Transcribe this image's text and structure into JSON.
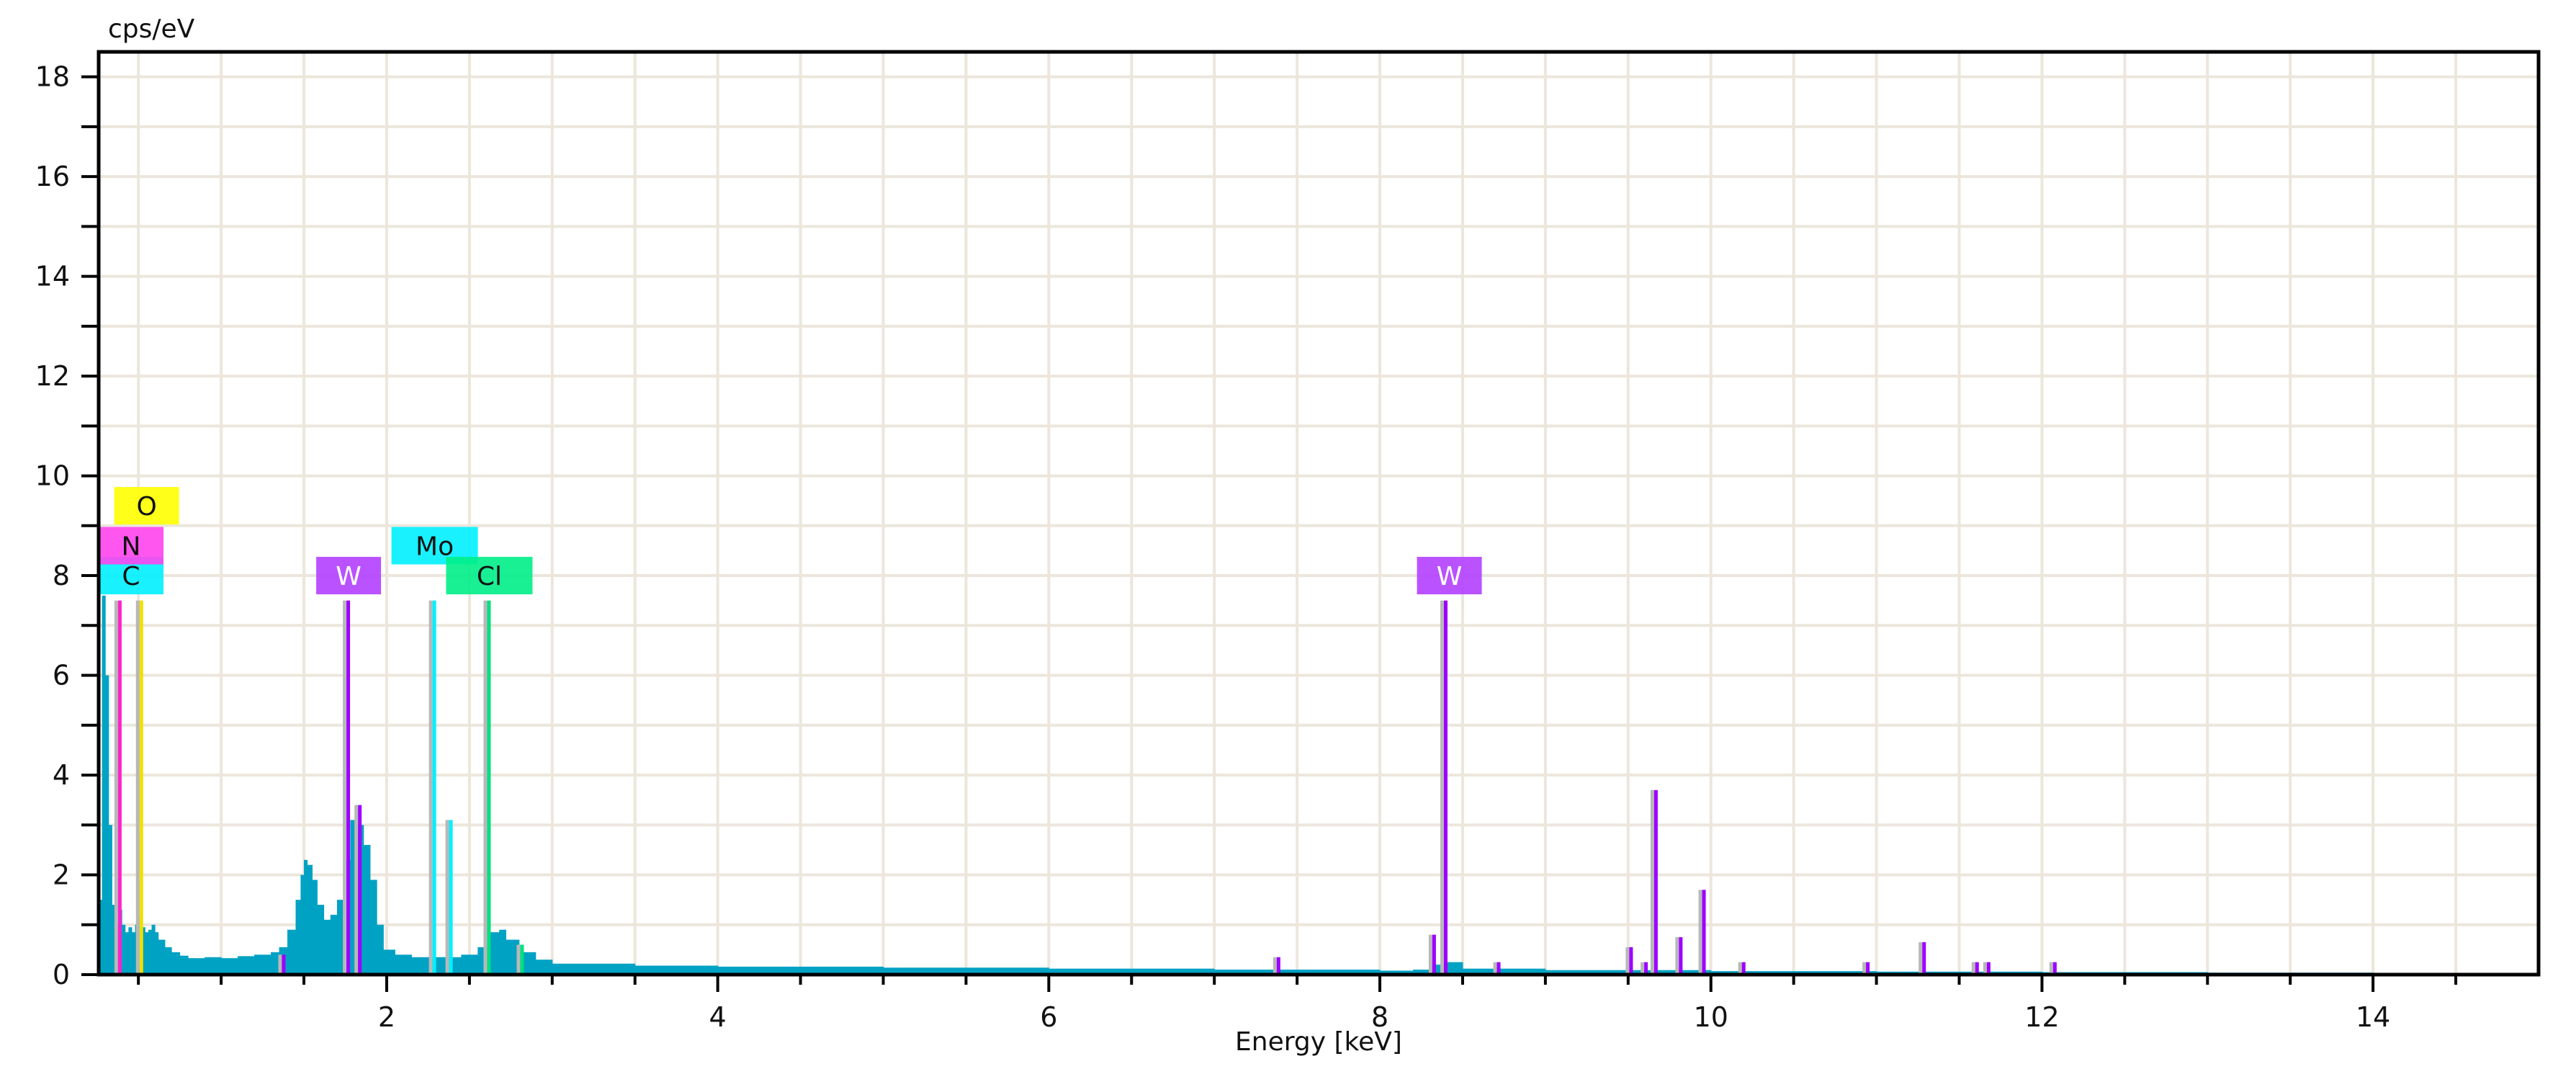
{
  "chart_data": {
    "type": "bar",
    "title": "",
    "xlabel": "Energy [keV]",
    "ylabel": "cps/eV",
    "xlim": [
      0.26,
      15.0
    ],
    "ylim": [
      0,
      18.5
    ],
    "grid": true,
    "xticks": [
      2,
      4,
      6,
      8,
      10,
      12,
      14
    ],
    "yticks": [
      0,
      2,
      4,
      6,
      8,
      10,
      12,
      14,
      16,
      18
    ],
    "spectrum_color": "#00a2c4",
    "spectrum": [
      [
        0.26,
        1.5
      ],
      [
        0.28,
        7.6
      ],
      [
        0.3,
        6.0
      ],
      [
        0.32,
        3.0
      ],
      [
        0.34,
        1.4
      ],
      [
        0.36,
        1.0
      ],
      [
        0.38,
        1.3
      ],
      [
        0.4,
        1.0
      ],
      [
        0.42,
        0.85
      ],
      [
        0.44,
        0.95
      ],
      [
        0.46,
        0.85
      ],
      [
        0.48,
        1.0
      ],
      [
        0.5,
        1.15
      ],
      [
        0.52,
        0.95
      ],
      [
        0.54,
        0.85
      ],
      [
        0.56,
        0.9
      ],
      [
        0.58,
        1.0
      ],
      [
        0.6,
        0.85
      ],
      [
        0.62,
        0.7
      ],
      [
        0.66,
        0.55
      ],
      [
        0.7,
        0.45
      ],
      [
        0.75,
        0.38
      ],
      [
        0.8,
        0.33
      ],
      [
        0.9,
        0.35
      ],
      [
        1.0,
        0.33
      ],
      [
        1.1,
        0.37
      ],
      [
        1.2,
        0.4
      ],
      [
        1.3,
        0.45
      ],
      [
        1.35,
        0.55
      ],
      [
        1.4,
        0.9
      ],
      [
        1.45,
        1.5
      ],
      [
        1.48,
        2.0
      ],
      [
        1.5,
        2.3
      ],
      [
        1.52,
        2.2
      ],
      [
        1.55,
        1.9
      ],
      [
        1.58,
        1.4
      ],
      [
        1.62,
        1.1
      ],
      [
        1.66,
        1.2
      ],
      [
        1.7,
        1.5
      ],
      [
        1.74,
        2.3
      ],
      [
        1.78,
        3.1
      ],
      [
        1.82,
        3.0
      ],
      [
        1.86,
        2.6
      ],
      [
        1.9,
        1.9
      ],
      [
        1.94,
        1.0
      ],
      [
        1.98,
        0.5
      ],
      [
        2.05,
        0.4
      ],
      [
        2.15,
        0.35
      ],
      [
        2.3,
        0.35
      ],
      [
        2.45,
        0.4
      ],
      [
        2.55,
        0.55
      ],
      [
        2.62,
        0.85
      ],
      [
        2.68,
        0.9
      ],
      [
        2.72,
        0.7
      ],
      [
        2.8,
        0.45
      ],
      [
        2.9,
        0.3
      ],
      [
        3.0,
        0.22
      ],
      [
        3.5,
        0.18
      ],
      [
        4.0,
        0.16
      ],
      [
        5.0,
        0.14
      ],
      [
        6.0,
        0.12
      ],
      [
        7.0,
        0.1
      ],
      [
        8.0,
        0.08
      ],
      [
        8.2,
        0.1
      ],
      [
        8.3,
        0.2
      ],
      [
        8.4,
        0.25
      ],
      [
        8.5,
        0.12
      ],
      [
        9.0,
        0.09
      ],
      [
        10.0,
        0.07
      ],
      [
        11.0,
        0.06
      ],
      [
        12.0,
        0.05
      ],
      [
        13.0,
        0.04
      ],
      [
        14.0,
        0.03
      ],
      [
        14.6,
        0.0
      ]
    ],
    "marker_lines": [
      {
        "energy": 0.39,
        "height": 7.5,
        "color": "#ff22cc"
      },
      {
        "energy": 0.52,
        "height": 7.5,
        "color": "#f0e000"
      },
      {
        "energy": 1.77,
        "height": 7.5,
        "color": "#9d00ff"
      },
      {
        "energy": 1.84,
        "height": 3.4,
        "color": "#9d00ff"
      },
      {
        "energy": 1.38,
        "height": 0.4,
        "color": "#9d00ff"
      },
      {
        "energy": 2.29,
        "height": 7.5,
        "color": "#00f0ff"
      },
      {
        "energy": 2.39,
        "height": 3.1,
        "color": "#00f0ff"
      },
      {
        "energy": 2.62,
        "height": 7.5,
        "color": "#00e080"
      },
      {
        "energy": 2.82,
        "height": 0.6,
        "color": "#00e080"
      },
      {
        "energy": 7.39,
        "height": 0.35,
        "color": "#9d00ff"
      },
      {
        "energy": 8.33,
        "height": 0.8,
        "color": "#9d00ff"
      },
      {
        "energy": 8.4,
        "height": 7.5,
        "color": "#9d00ff"
      },
      {
        "energy": 8.72,
        "height": 0.25,
        "color": "#9d00ff"
      },
      {
        "energy": 9.52,
        "height": 0.55,
        "color": "#9d00ff"
      },
      {
        "energy": 9.61,
        "height": 0.25,
        "color": "#9d00ff"
      },
      {
        "energy": 9.67,
        "height": 3.7,
        "color": "#9d00ff"
      },
      {
        "energy": 9.82,
        "height": 0.75,
        "color": "#9d00ff"
      },
      {
        "energy": 9.96,
        "height": 1.7,
        "color": "#9d00ff"
      },
      {
        "energy": 10.2,
        "height": 0.25,
        "color": "#9d00ff"
      },
      {
        "energy": 10.95,
        "height": 0.25,
        "color": "#9d00ff"
      },
      {
        "energy": 11.29,
        "height": 0.65,
        "color": "#9d00ff"
      },
      {
        "energy": 11.61,
        "height": 0.25,
        "color": "#9d00ff"
      },
      {
        "energy": 11.68,
        "height": 0.25,
        "color": "#9d00ff"
      },
      {
        "energy": 12.08,
        "height": 0.25,
        "color": "#9d00ff"
      }
    ],
    "element_labels": [
      {
        "text": "C",
        "energy": 0.28,
        "level": 8.0,
        "bg": "#00f0ff",
        "fg": "#111111"
      },
      {
        "text": "N",
        "energy": 0.38,
        "level": 8.6,
        "bg": "#ff44ee",
        "fg": "#111111"
      },
      {
        "text": "O",
        "energy": 0.55,
        "level": 9.4,
        "bg": "#ffff00",
        "fg": "#111111"
      },
      {
        "text": "W",
        "energy": 1.77,
        "level": 8.0,
        "bg": "#b340ff",
        "fg": "#ffffff"
      },
      {
        "text": "Mo",
        "energy": 2.29,
        "level": 8.6,
        "bg": "#00f0ff",
        "fg": "#111111"
      },
      {
        "text": "Cl",
        "energy": 2.62,
        "level": 8.0,
        "bg": "#00ee88",
        "fg": "#111111"
      },
      {
        "text": "W",
        "energy": 8.42,
        "level": 8.0,
        "bg": "#b340ff",
        "fg": "#ffffff"
      }
    ]
  }
}
